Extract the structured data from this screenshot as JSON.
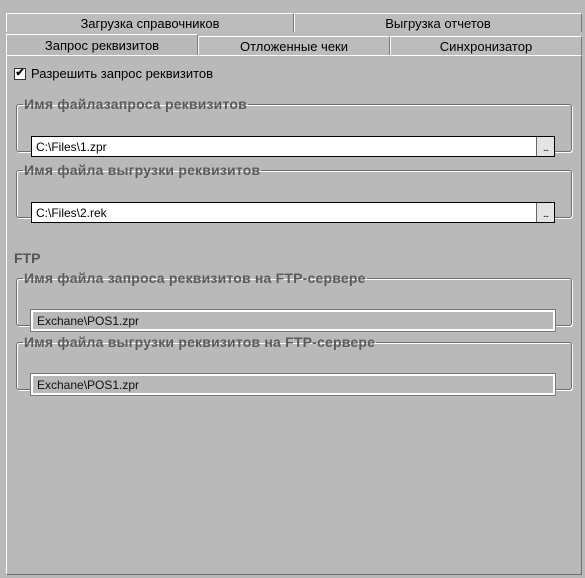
{
  "tabs": {
    "back_row": [
      {
        "label": "Загрузка справочников"
      },
      {
        "label": "Выгрузка отчетов"
      }
    ],
    "front_row": [
      {
        "label": "Запрос реквизитов",
        "active": true
      },
      {
        "label": "Отложенные чеки"
      },
      {
        "label": "Синхронизатор"
      }
    ]
  },
  "allow_request": {
    "label": "Разрешить запрос реквизитов",
    "checked": true,
    "check_mark": "✔"
  },
  "request_file": {
    "legend": "Имя файлазапроса реквизитов",
    "value": "C:\\Files\\1.zpr",
    "browse": "..."
  },
  "export_file": {
    "legend": "Имя файла выгрузки реквизитов",
    "value": "C:\\Files\\2.rek",
    "browse": "..."
  },
  "ftp": {
    "title": "FTP",
    "request_file": {
      "legend": "Имя файла запроса реквизитов на FTP-сервере",
      "value": "Exchane\\POS1.zpr"
    },
    "export_file": {
      "legend": "Имя файла выгрузки реквизитов на FTP-сервере",
      "value": "Exchane\\POS1.zpr"
    }
  }
}
